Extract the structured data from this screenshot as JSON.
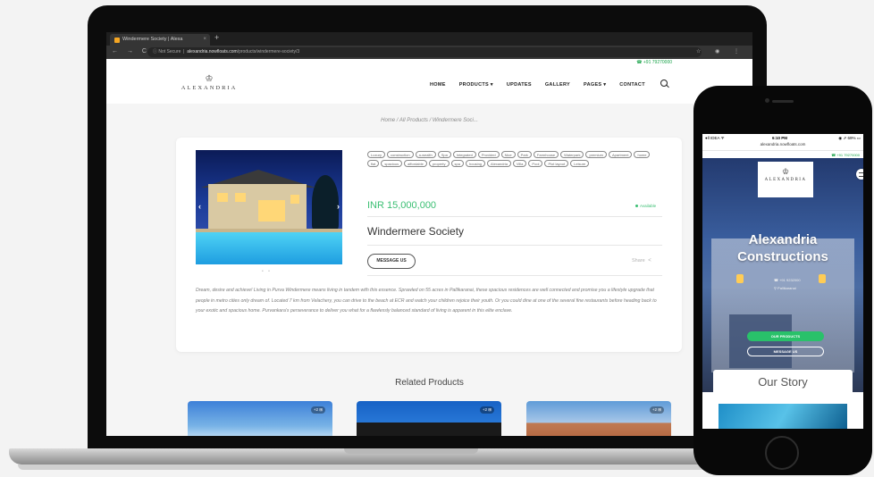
{
  "browser": {
    "tab_title": "Windermere Society | Alexa",
    "tab_close": "×",
    "new_tab": "+",
    "nav_buttons": "← → C",
    "security": "ⓘ Not Secure",
    "url_host": "alexandria.nowfloats.com",
    "url_path": "/products/windermere-society/3",
    "tools": "☆ ◉ ⋮"
  },
  "site": {
    "top_phone": "☎ +91 79270000",
    "logo_mark": "♔",
    "logo_text": "ALEXANDRIA",
    "menu": [
      "HOME",
      "PRODUCTS ▾",
      "UPDATES",
      "GALLERY",
      "PAGES ▾",
      "CONTACT"
    ],
    "breadcrumb": "Home / All Products / Windermere Soci..."
  },
  "product": {
    "tags": [
      "Luxury",
      "construction",
      "a-wealth",
      "Spa",
      "Integrated",
      "Provided",
      "Nice",
      "Park",
      "Farmhouse",
      "Waterpark",
      "premium",
      "Apartment",
      "home",
      "flat",
      "spacious",
      "affordable",
      "property",
      "spa",
      "housing",
      "Alexandria",
      "Villa",
      "Pool",
      "Plot layout",
      "Leisure"
    ],
    "price": "INR 15,000,000",
    "availability": "Available",
    "title": "Windermere Society",
    "message_button": "MESSAGE US",
    "share_label": "Share",
    "share_icon": "<",
    "photo_prev": "‹",
    "photo_next": "›",
    "photo_dots": "• •",
    "description": "Dream, desire and achieve! Living in Purva Windermere means living in tandem with this essence. Sprawled on 55 acres in Pallikaranai, these spacious residences are well connected and promise you a lifestyle upgrade that people in metro cities only dream of. Located 7 km from Velachery, you can drive to the beach at ECR and watch your children rejoice their youth. Or you could dine at one of the several fine restaurants before heading back to your exotic and spacious home. Purvankara's perseverance to deliver you what for a flawlessly balanced standard of living is apparent in this elite enclave."
  },
  "related": {
    "title": "Related Products",
    "badges": [
      "+2 ⊞",
      "+2 ⊞",
      "+2 ⊞"
    ]
  },
  "phone": {
    "carrier": "●ll IDEA ᯤ",
    "time": "6:10 PM",
    "battery": "◉ ⇗ 69% ▭",
    "url": "alexandria.nowfloats.com",
    "top_phone": "☎ +91 79270000",
    "logo_mark": "♔",
    "logo_text": "ALEXANDRIA",
    "title_line1": "Alexandria",
    "title_line2": "Constructions",
    "info_phone": "☎ +91 9232000",
    "info_place": "⚲ Pallikaranai",
    "cta_primary": "OUR PRODUCTS",
    "cta_secondary": "MESSAGE US",
    "story_title": "Our Story"
  },
  "colors": {
    "accent_green": "#3bbf73",
    "cta_green": "#29c16a",
    "browser_dark": "#1f1f1f"
  }
}
